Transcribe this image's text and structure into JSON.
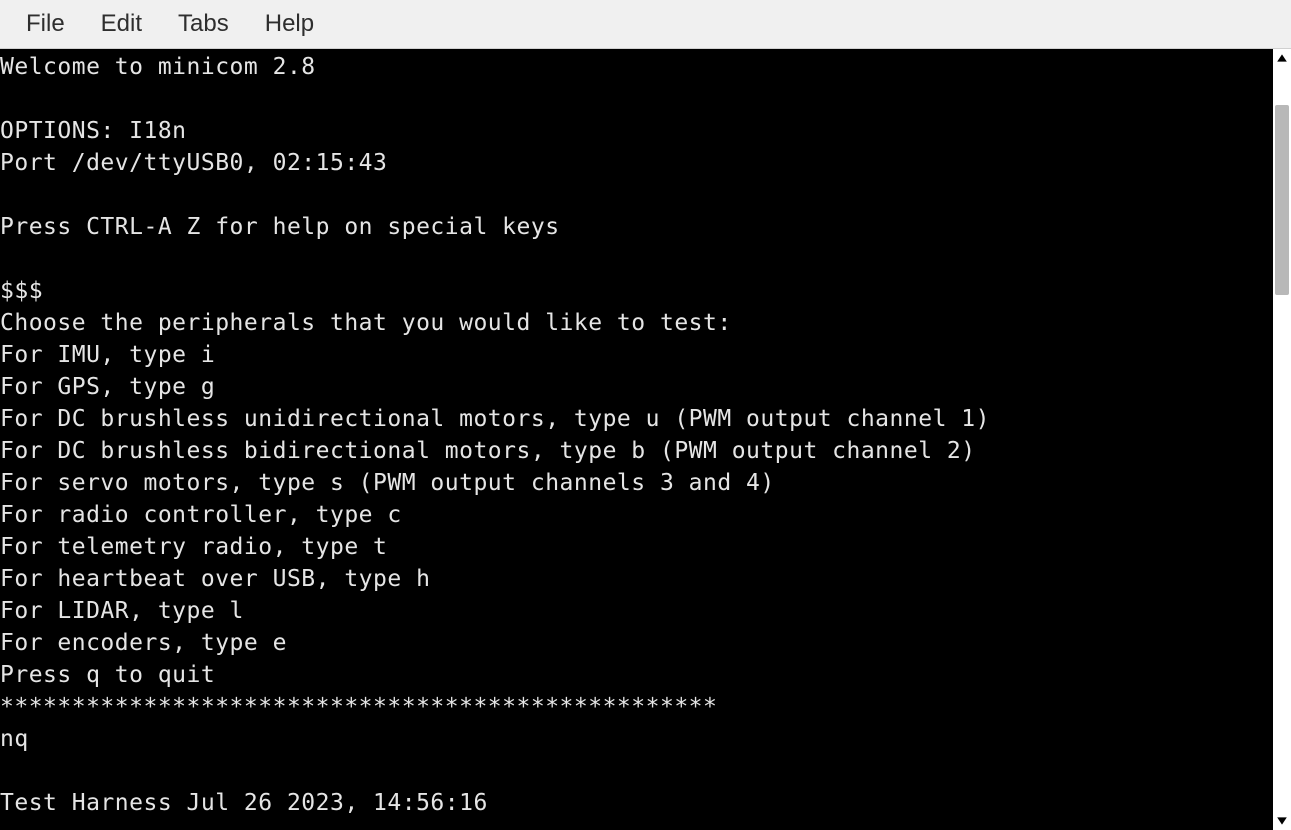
{
  "menubar": {
    "file": "File",
    "edit": "Edit",
    "tabs": "Tabs",
    "help": "Help"
  },
  "terminal": {
    "lines": [
      "Welcome to minicom 2.8",
      "",
      "OPTIONS: I18n",
      "Port /dev/ttyUSB0, 02:15:43",
      "",
      "Press CTRL-A Z for help on special keys",
      "",
      "$$$",
      "Choose the peripherals that you would like to test:",
      "For IMU, type i",
      "For GPS, type g",
      "For DC brushless unidirectional motors, type u (PWM output channel 1)",
      "For DC brushless bidirectional motors, type b (PWM output channel 2)",
      "For servo motors, type s (PWM output channels 3 and 4)",
      "For radio controller, type c",
      "For telemetry radio, type t",
      "For heartbeat over USB, type h",
      "For LIDAR, type l",
      "For encoders, type e",
      "Press q to quit",
      "**************************************************",
      "nq",
      "",
      "Test Harness Jul 26 2023, 14:56:16"
    ]
  }
}
